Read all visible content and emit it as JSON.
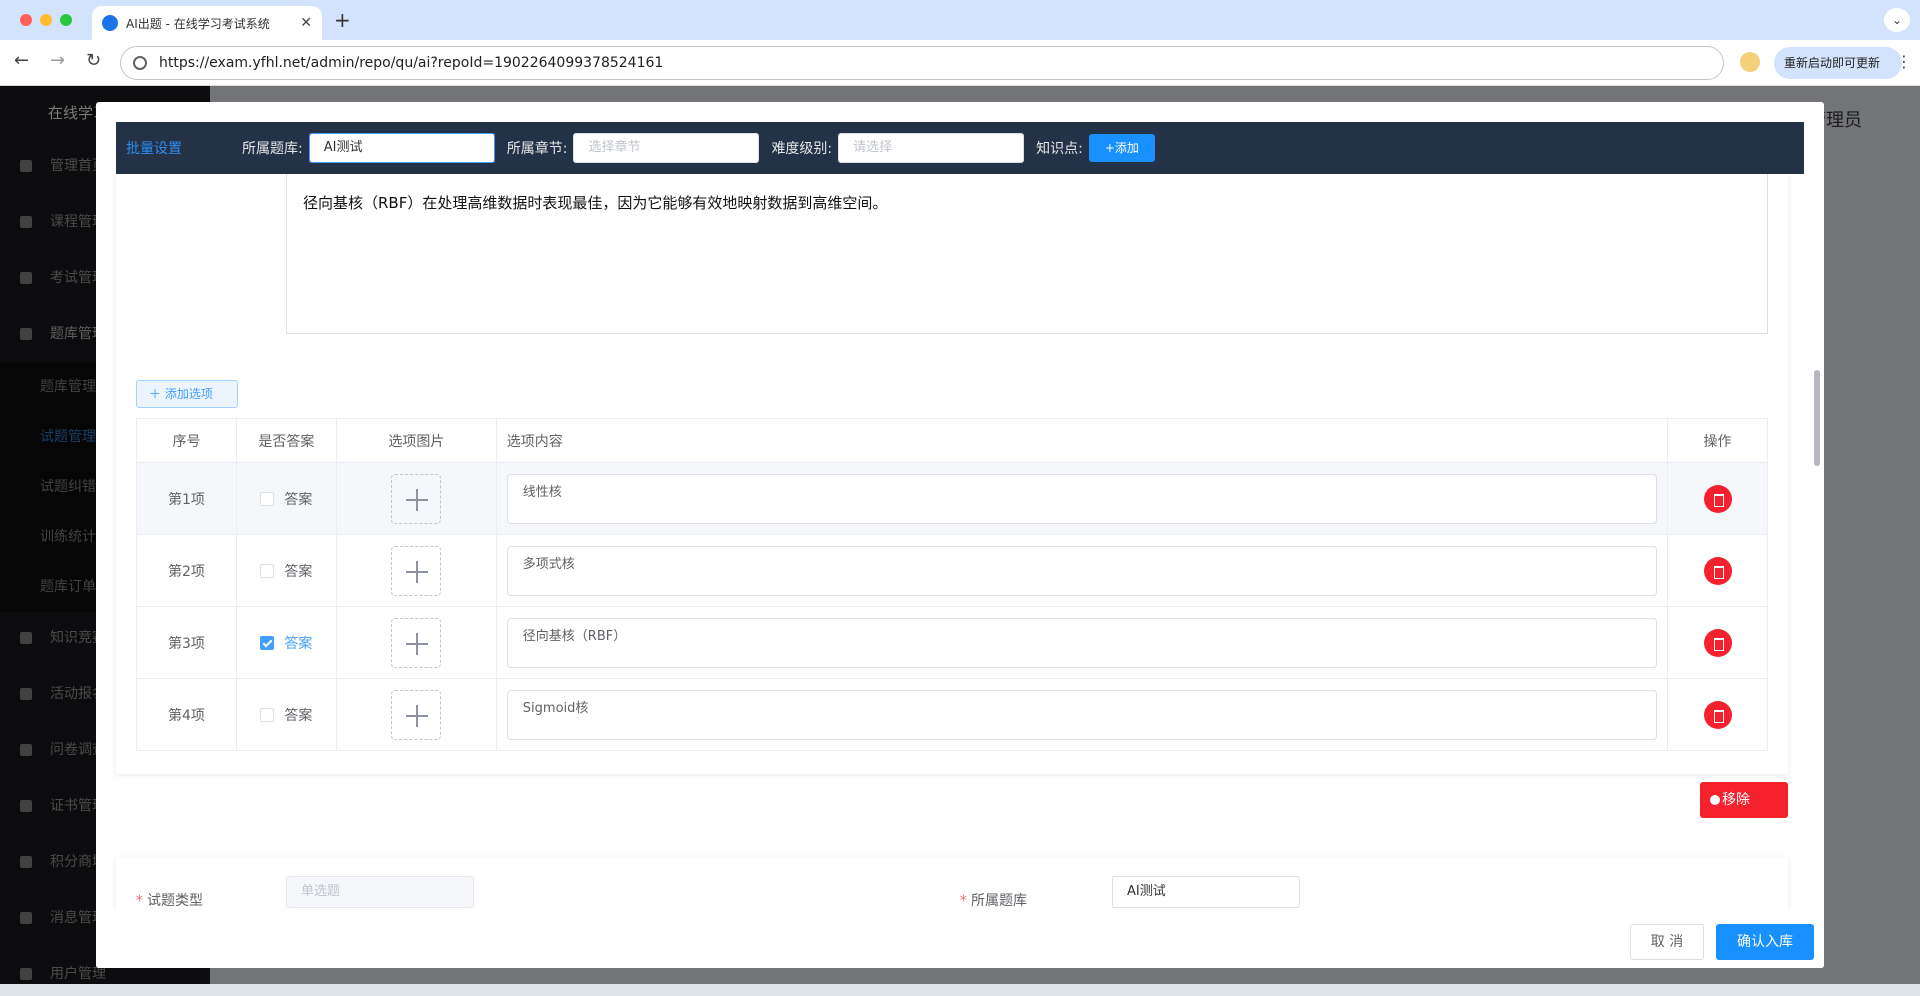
{
  "browser": {
    "tab_title": "AI出题 - 在线学习考试系统",
    "url": "https://exam.yfhl.net/admin/repo/qu/ai?repoId=1902264099378524161",
    "update_label": "重新启动即可更新"
  },
  "app": {
    "title": "在线学习",
    "admin_label": "管理员",
    "sidebar": {
      "items": [
        {
          "label": "管理首页"
        },
        {
          "label": "课程管理"
        },
        {
          "label": "考试管理"
        },
        {
          "label": "题库管理"
        },
        {
          "label": "知识竞赛"
        },
        {
          "label": "活动报名"
        },
        {
          "label": "问卷调查"
        },
        {
          "label": "证书管理"
        },
        {
          "label": "积分商城"
        },
        {
          "label": "消息管理"
        },
        {
          "label": "用户管理"
        }
      ],
      "sub_items": [
        {
          "label": "题库管理"
        },
        {
          "label": "试题管理"
        },
        {
          "label": "试题纠错"
        },
        {
          "label": "训练统计"
        },
        {
          "label": "题库订单"
        }
      ]
    }
  },
  "batch": {
    "title": "批量设置",
    "repo_label": "所属题库:",
    "repo_value": "AI测试",
    "chapter_label": "所属章节:",
    "chapter_placeholder": "选择章节",
    "level_label": "难度级别:",
    "level_placeholder": "请选择",
    "kp_label": "知识点:",
    "kp_add": "+添加"
  },
  "question": {
    "text": "径向基核（RBF）在处理高维数据时表现最佳，因为它能够有效地映射数据到高维空间。"
  },
  "options": {
    "add_label": "添加选项",
    "headers": {
      "index": "序号",
      "is_answer": "是否答案",
      "image": "选项图片",
      "content": "选项内容",
      "action": "操作"
    },
    "answer_label": "答案",
    "rows": [
      {
        "index": "第1项",
        "content": "线性核",
        "checked": false
      },
      {
        "index": "第2项",
        "content": "多项式核",
        "checked": false
      },
      {
        "index": "第3项",
        "content": "径向基核（RBF）",
        "checked": true
      },
      {
        "index": "第4项",
        "content": "Sigmoid核",
        "checked": false
      }
    ]
  },
  "remove_label": "移除",
  "form": {
    "type_label": "试题类型",
    "type_value": "单选题",
    "repo_label": "所属题库",
    "repo_value": "AI测试"
  },
  "footer": {
    "cancel": "取 消",
    "confirm": "确认入库"
  }
}
